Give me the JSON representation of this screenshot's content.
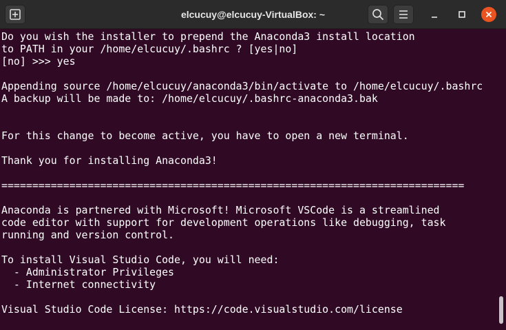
{
  "window": {
    "title": "elcucuy@elcucuy-VirtualBox: ~"
  },
  "icons": {
    "new_tab": "new-tab-icon",
    "search": "search-icon",
    "menu": "hamburger-menu-icon",
    "minimize": "minimize-icon",
    "maximize": "maximize-icon",
    "close": "close-icon"
  },
  "colors": {
    "terminal_background": "#300a24",
    "titlebar": "#2b2b2b",
    "text": "#ffffff",
    "close_button": "#e95420"
  },
  "terminal": {
    "lines": [
      "Do you wish the installer to prepend the Anaconda3 install location",
      "to PATH in your /home/elcucuy/.bashrc ? [yes|no]",
      "[no] >>> yes",
      "",
      "Appending source /home/elcucuy/anaconda3/bin/activate to /home/elcucuy/.bashrc",
      "A backup will be made to: /home/elcucuy/.bashrc-anaconda3.bak",
      "",
      "",
      "For this change to become active, you have to open a new terminal.",
      "",
      "Thank you for installing Anaconda3!",
      "",
      "===========================================================================",
      "",
      "Anaconda is partnered with Microsoft! Microsoft VSCode is a streamlined",
      "code editor with support for development operations like debugging, task",
      "running and version control.",
      "",
      "To install Visual Studio Code, you will need:",
      "  - Administrator Privileges",
      "  - Internet connectivity",
      "",
      "Visual Studio Code License: https://code.visualstudio.com/license"
    ]
  }
}
